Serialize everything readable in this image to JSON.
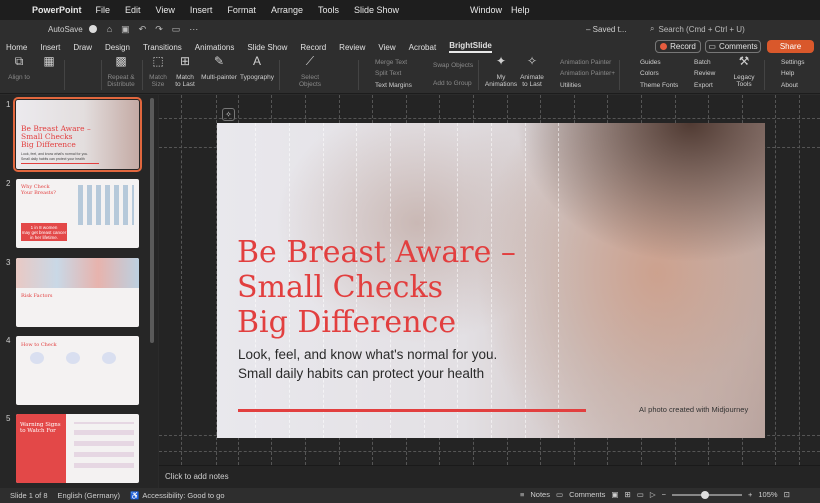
{
  "menubar": {
    "app": "PowerPoint",
    "items": [
      "File",
      "Edit",
      "View",
      "Insert",
      "Format",
      "Arrange",
      "Tools",
      "Slide Show"
    ],
    "window": "Window",
    "help": "Help"
  },
  "titlebar": {
    "autosave": "AutoSave",
    "doc_title": "– Saved t...",
    "search_placeholder": "Search (Cmd + Ctrl + U)"
  },
  "tabs": [
    "Home",
    "Insert",
    "Draw",
    "Design",
    "Transitions",
    "Animations",
    "Slide Show",
    "Record",
    "Review",
    "View",
    "Acrobat",
    "BrightSlide"
  ],
  "active_tab": "BrightSlide",
  "top_buttons": {
    "record": "Record",
    "comments": "Comments",
    "share": "Share"
  },
  "ribbon": {
    "align_to": "Align to",
    "repeat_distribute": [
      "Repeat &",
      "Distribute"
    ],
    "match_size": [
      "Match",
      "Size"
    ],
    "match_to_last": [
      "Match",
      "to Last"
    ],
    "multi_painter": "Multi-painter",
    "typography": "Typography",
    "select_objects": [
      "Select",
      "Objects"
    ],
    "merge_text": "Merge Text",
    "split_text": "Split Text",
    "text_margins": "Text Margins",
    "swap_objects": "Swap Objects",
    "add_to_group": "Add to Group",
    "my_animations": [
      "My",
      "Animations"
    ],
    "animate_to_last": [
      "Animate",
      "to Last"
    ],
    "animation_painter": "Animation Painter",
    "animation_painter_plus": "Animation Painter+",
    "utilities": "Utilities",
    "guides": "Guides",
    "colors": "Colors",
    "theme_fonts": "Theme Fonts",
    "batch": "Batch",
    "review": "Review",
    "export": "Export",
    "legacy_tools": [
      "Legacy",
      "Tools"
    ],
    "settings": "Settings",
    "help": "Help",
    "about": "About"
  },
  "thumbnails": [
    {
      "num": "1",
      "title": [
        "Be Breast Aware –",
        "Small Checks",
        "Big Difference"
      ],
      "sub": "Look, feel, and know what's normal for you. Small daily habits can protect your health"
    },
    {
      "num": "2",
      "title": [
        "Why Check",
        "Your Breasts?"
      ],
      "box": [
        "1 in 8 women",
        "may get breast cancer",
        "in her lifetime."
      ]
    },
    {
      "num": "3",
      "title": [
        "Risk Factors"
      ]
    },
    {
      "num": "4",
      "title": [
        "How to Check"
      ]
    },
    {
      "num": "5",
      "title": [
        "Warning Signs",
        "to Watch For"
      ]
    }
  ],
  "slide": {
    "title_lines": [
      "Be Breast Aware –",
      "Small Checks",
      "Big Difference"
    ],
    "subtitle_lines": [
      "Look, feel, and know what's normal for you.",
      "Small daily habits can protect your health"
    ],
    "credit": "AI photo created with Midjourney"
  },
  "notes_placeholder": "Click to add notes",
  "status": {
    "slide_of": "Slide 1 of 8",
    "language": "English (Germany)",
    "accessibility": "Accessibility: Good to go",
    "notes": "Notes",
    "comments": "Comments",
    "zoom": "105%",
    "zoom_fraction": 0.42
  },
  "colors": {
    "accent": "#e23f3f",
    "share": "#d9582b",
    "record_dot": "#e65c3e"
  }
}
